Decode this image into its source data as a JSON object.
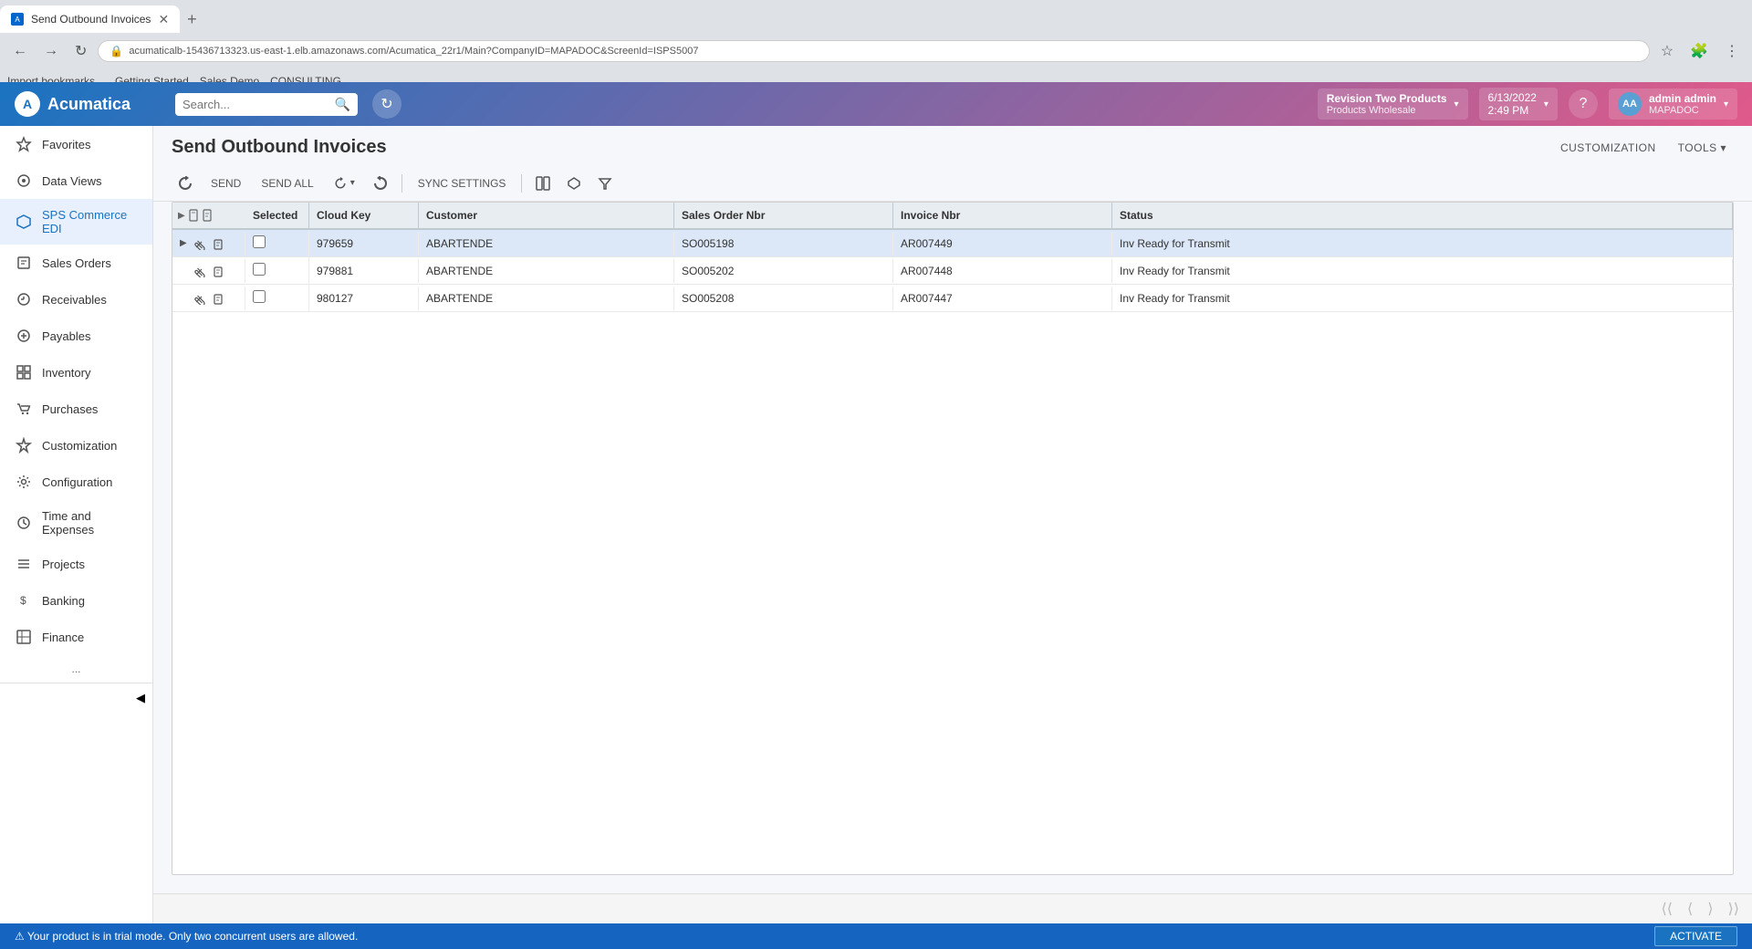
{
  "browser": {
    "tab_title": "Send Outbound Invoices",
    "url": "acumaticalb-15436713323.us-east-1.elb.amazonaws.com/Acumatica_22r1/Main?CompanyID=MAPADOC&ScreenId=ISPS5007",
    "bookmarks": [
      {
        "label": "Import bookmarks..."
      },
      {
        "label": "Getting Started"
      },
      {
        "label": "Sales Demo"
      },
      {
        "label": "CONSULTING"
      }
    ]
  },
  "header": {
    "logo": "Acumatica",
    "search_placeholder": "Search...",
    "company_name": "Revision Two Products",
    "company_sub": "Products Wholesale",
    "date": "6/13/2022",
    "time": "2:49 PM",
    "user_name": "admin admin",
    "user_company": "MAPADOC",
    "help_icon": "?",
    "chevron": "▾"
  },
  "sidebar": {
    "items": [
      {
        "id": "favorites",
        "label": "Favorites",
        "icon": "★"
      },
      {
        "id": "data-views",
        "label": "Data Views",
        "icon": "◉"
      },
      {
        "id": "sps-commerce-edi",
        "label": "SPS Commerce EDI",
        "icon": "⬡",
        "active": true
      },
      {
        "id": "sales-orders",
        "label": "Sales Orders",
        "icon": "✏"
      },
      {
        "id": "receivables",
        "label": "Receivables",
        "icon": "⊖"
      },
      {
        "id": "payables",
        "label": "Payables",
        "icon": "⊕"
      },
      {
        "id": "inventory",
        "label": "Inventory",
        "icon": "▣"
      },
      {
        "id": "purchases",
        "label": "Purchases",
        "icon": "🛒"
      },
      {
        "id": "customization",
        "label": "Customization",
        "icon": "✦"
      },
      {
        "id": "configuration",
        "label": "Configuration",
        "icon": "⚙"
      },
      {
        "id": "time-expenses",
        "label": "Time and Expenses",
        "icon": "⏱"
      },
      {
        "id": "projects",
        "label": "Projects",
        "icon": "≡"
      },
      {
        "id": "banking",
        "label": "Banking",
        "icon": "$"
      },
      {
        "id": "finance",
        "label": "Finance",
        "icon": "▦"
      }
    ],
    "more_label": "...",
    "collapse_icon": "◀"
  },
  "page": {
    "title": "Send Outbound Invoices",
    "customization_label": "CUSTOMIZATION",
    "tools_label": "TOOLS ▾"
  },
  "toolbar": {
    "refresh_icon": "↻",
    "send_label": "SEND",
    "send_all_label": "SEND ALL",
    "sync_icon": "↻",
    "sync_dropdown": "▾",
    "reset_icon": "↺",
    "sync_settings_label": "SYNC SETTINGS",
    "column_chooser_icon": "⊞",
    "export_icon": "⬡",
    "filter_icon": "▽"
  },
  "grid": {
    "columns": [
      {
        "id": "controls",
        "label": ""
      },
      {
        "id": "selected",
        "label": "Selected"
      },
      {
        "id": "cloudkey",
        "label": "Cloud Key"
      },
      {
        "id": "customer",
        "label": "Customer"
      },
      {
        "id": "salesorder",
        "label": "Sales Order Nbr"
      },
      {
        "id": "invoice",
        "label": "Invoice Nbr"
      },
      {
        "id": "status",
        "label": "Status"
      }
    ],
    "rows": [
      {
        "id": 1,
        "selected": false,
        "cloudkey": "979659",
        "customer": "ABARTENDE",
        "salesorder": "SO005198",
        "invoice": "AR007449",
        "status": "Inv Ready for Transmit",
        "highlighted": true
      },
      {
        "id": 2,
        "selected": false,
        "cloudkey": "979881",
        "customer": "ABARTENDE",
        "salesorder": "SO005202",
        "invoice": "AR007448",
        "status": "Inv Ready for Transmit",
        "highlighted": false
      },
      {
        "id": 3,
        "selected": false,
        "cloudkey": "980127",
        "customer": "ABARTENDE",
        "salesorder": "SO005208",
        "invoice": "AR007447",
        "status": "Inv Ready for Transmit",
        "highlighted": false
      }
    ]
  },
  "pagination": {
    "first_icon": "⟨⟨",
    "prev_icon": "⟨",
    "next_icon": "⟩",
    "last_icon": "⟩⟩"
  },
  "statusbar": {
    "message": "⚠ Your product is in trial mode. Only two concurrent users are allowed.",
    "activate_label": "ACTIVATE"
  }
}
